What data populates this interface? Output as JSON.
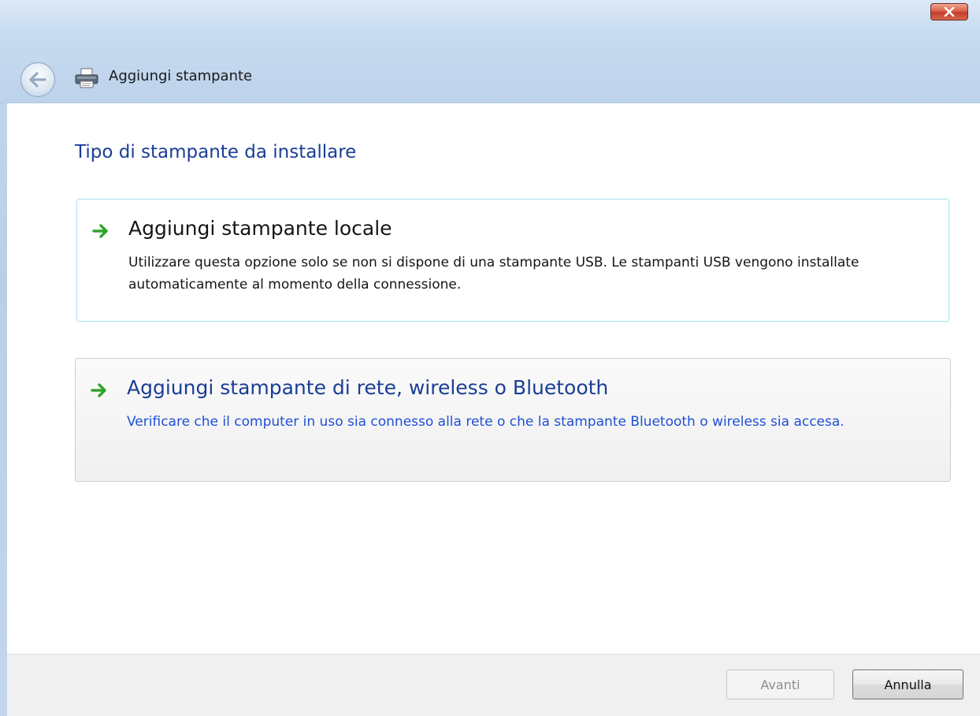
{
  "window": {
    "title": "Aggiungi stampante",
    "icons": {
      "back": "back-arrow-icon",
      "app": "printer-icon",
      "close": "close-icon"
    }
  },
  "page": {
    "heading": "Tipo di stampante da installare"
  },
  "options": [
    {
      "title": "Aggiungi stampante locale",
      "description": "Utilizzare questa opzione solo se non si dispone di una stampante USB. Le stampanti USB vengono installate automaticamente al momento della connessione.",
      "icon": "green-arrow-icon"
    },
    {
      "title": "Aggiungi stampante di rete, wireless o Bluetooth",
      "description": "Verificare che il computer in uso sia connesso alla rete o che la stampante Bluetooth o wireless sia accesa.",
      "icon": "green-arrow-icon"
    }
  ],
  "buttons": {
    "next": "Avanti",
    "cancel": "Annulla"
  },
  "colors": {
    "heading": "#1a3e96",
    "link": "#1f4fd6",
    "arrow": "#2fa52b",
    "selected_border": "#a9e4f4"
  }
}
